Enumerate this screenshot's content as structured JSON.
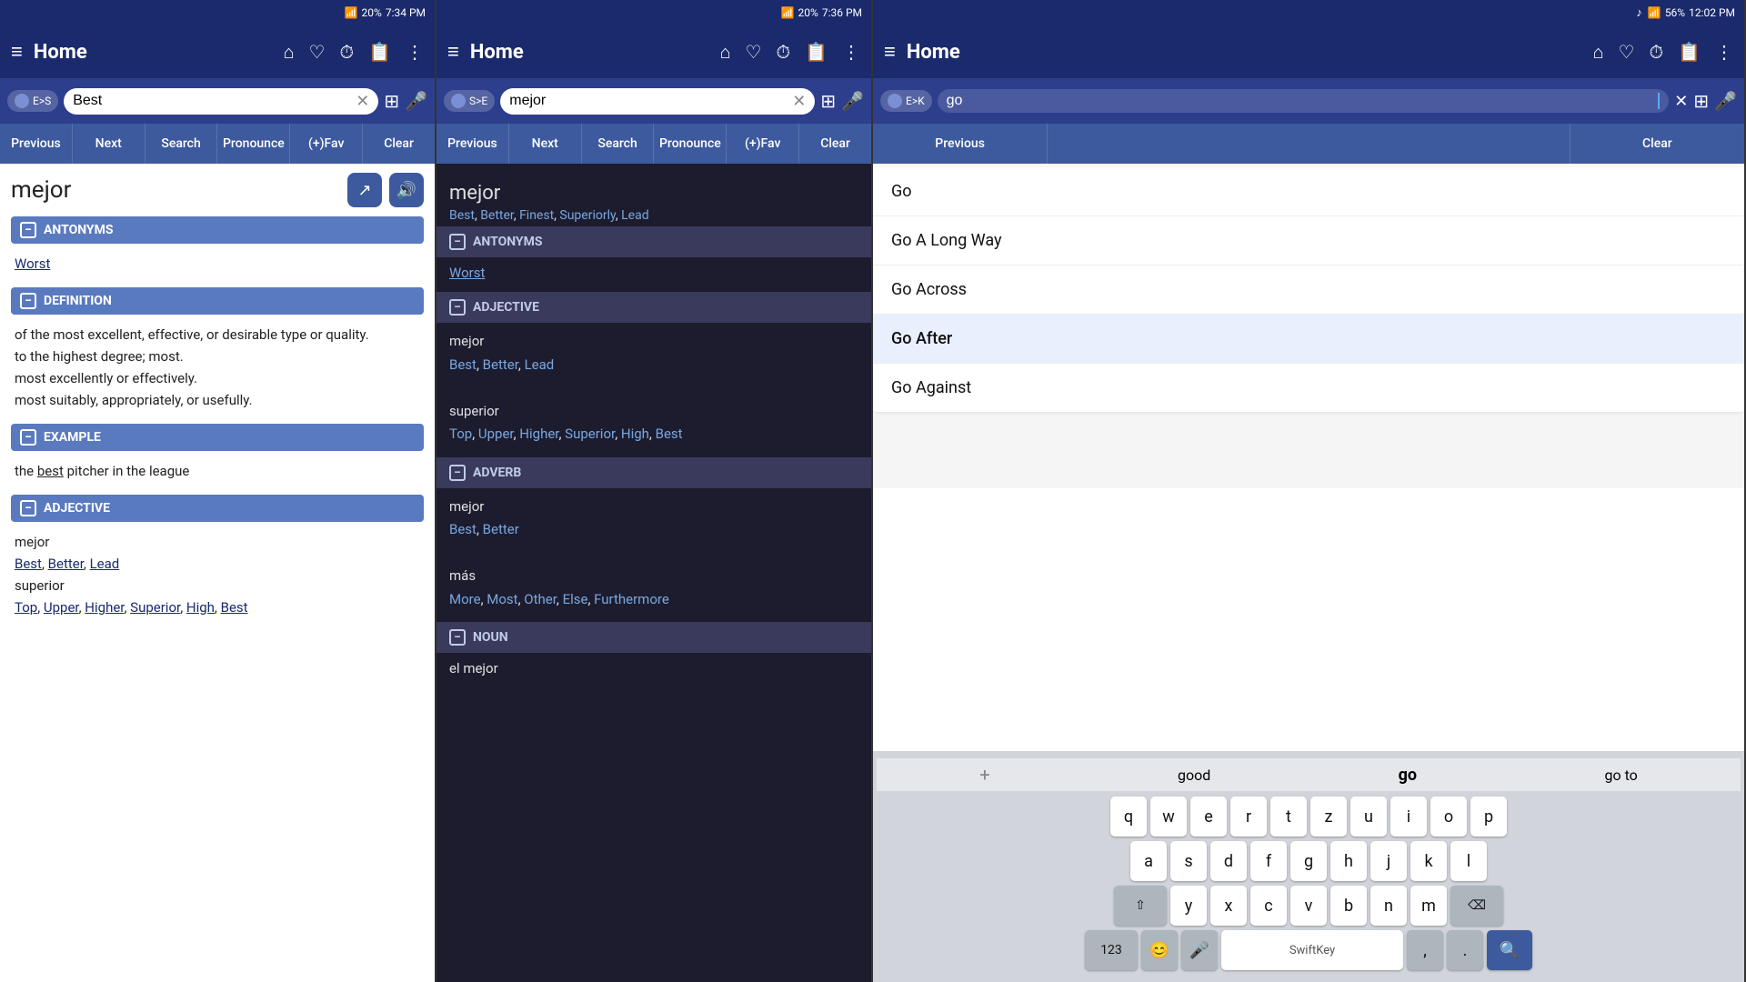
{
  "panel1": {
    "statusBar": {
      "simIcon": "📶",
      "batteryPercent": "20%",
      "time": "7:34 PM"
    },
    "appBar": {
      "menuIcon": "≡",
      "title": "Home",
      "homeIcon": "⌂",
      "heartIcon": "♡",
      "historyIcon": "⏱",
      "bookmarkIcon": "📋",
      "moreIcon": "⋮"
    },
    "searchBar": {
      "langToggle": "E>S",
      "searchValue": "Best",
      "clearIcon": "✕",
      "scanIcon": "⊞",
      "micIcon": "🎤"
    },
    "toolbar": {
      "buttons": [
        "Previous",
        "Next",
        "Search",
        "Pronounce",
        "(+)Fav",
        "Clear"
      ]
    },
    "wordHeader": {
      "word": "mejor",
      "shareIcon": "↗",
      "soundIcon": "🔊"
    },
    "sections": [
      {
        "id": "antonyms",
        "label": "ANTONYMS",
        "content": "Worst"
      },
      {
        "id": "definition",
        "label": "DEFINITION",
        "content": "of the most excellent, effective, or desirable type or quality.\nto the highest degree; most.\nmost excellently or effectively.\nmost suitably, appropriately, or usefully."
      },
      {
        "id": "example",
        "label": "EXAMPLE",
        "content": "the best pitcher in the league"
      },
      {
        "id": "adjective",
        "label": "ADJECTIVE",
        "content": "mejor\nBest, Better, Lead\nsuperior\nTop, Upper, Higher, Superior, High, Best"
      }
    ]
  },
  "panel2": {
    "statusBar": {
      "batteryPercent": "20%",
      "time": "7:36 PM"
    },
    "appBar": {
      "menuIcon": "≡",
      "title": "Home"
    },
    "searchBar": {
      "langToggle": "S>E",
      "searchValue": "mejor"
    },
    "toolbar": {
      "buttons": [
        "Previous",
        "Next",
        "Search",
        "Pronounce",
        "(+)Fav",
        "Clear"
      ]
    },
    "topWord": "mejor",
    "topTranslations": "Best, Better, Finest, Superiorly, Lead",
    "antonym": "Worst",
    "sections": [
      {
        "id": "adjective",
        "label": "ADJECTIVE",
        "entries": [
          {
            "word": "mejor",
            "translations": "Best, Better, Lead"
          },
          {
            "word": "superior",
            "translations": "Top, Upper, Higher, Superior, High, Best"
          }
        ]
      },
      {
        "id": "adverb",
        "label": "ADVERB",
        "entries": [
          {
            "word": "mejor",
            "translations": "Best, Better"
          },
          {
            "word": "más",
            "translations": "More, Most, Other, Else, Furthermore"
          }
        ]
      },
      {
        "id": "noun",
        "label": "NOUN",
        "entries": [
          {
            "word": "el mejor",
            "translations": ""
          }
        ]
      }
    ]
  },
  "panel3": {
    "statusBar": {
      "musicNote": "♪",
      "batteryPercent": "56%",
      "time": "12:02 PM"
    },
    "appBar": {
      "menuIcon": "≡",
      "title": "Home"
    },
    "searchBar": {
      "langToggle": "E>K",
      "searchValue": "go"
    },
    "toolbar": {
      "buttons": [
        "Previous",
        "Clear"
      ]
    },
    "dropdown": [
      {
        "label": "Go",
        "highlighted": false
      },
      {
        "label": "Go A Long Way",
        "highlighted": false
      },
      {
        "label": "Go Across",
        "highlighted": false
      },
      {
        "label": "Go After",
        "highlighted": true
      },
      {
        "label": "Go Against",
        "highlighted": false
      }
    ],
    "keyboard": {
      "suggestions": [
        "good",
        "go",
        "go to"
      ],
      "rows": [
        [
          "q",
          "w",
          "e",
          "r",
          "t",
          "z",
          "u",
          "i",
          "o",
          "p"
        ],
        [
          "a",
          "s",
          "d",
          "f",
          "g",
          "h",
          "j",
          "k",
          "l"
        ],
        [
          "y",
          "x",
          "c",
          "v",
          "b",
          "n",
          "m",
          "⌫"
        ],
        [
          "123",
          "😊",
          "🎤",
          "(space)",
          "",
          "",
          "",
          "↵"
        ]
      ]
    }
  }
}
